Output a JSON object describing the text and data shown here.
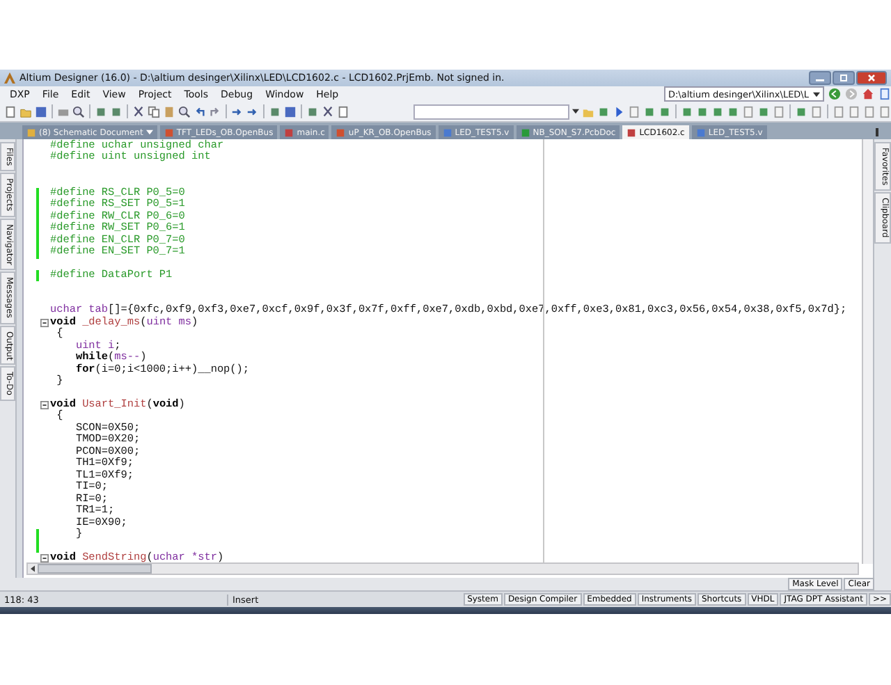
{
  "window": {
    "title": "Altium Designer (16.0) - D:\\altium desinger\\Xilinx\\LED\\LCD1602.c - LCD1602.PrjEmb. Not signed in."
  },
  "menu": [
    "DXP",
    "File",
    "Edit",
    "View",
    "Project",
    "Tools",
    "Debug",
    "Window",
    "Help"
  ],
  "path_field": {
    "value": "D:\\altium desinger\\Xilinx\\LED\\L"
  },
  "tabs": [
    {
      "label": "(8) Schematic Document",
      "kind": "menu",
      "selected": false
    },
    {
      "label": "TFT_LEDs_OB.OpenBus",
      "kind": "bus",
      "selected": false
    },
    {
      "label": "main.c",
      "kind": "c",
      "selected": false
    },
    {
      "label": "uP_KR_OB.OpenBus",
      "kind": "bus",
      "selected": false
    },
    {
      "label": "LED_TEST5.v",
      "kind": "v",
      "selected": false
    },
    {
      "label": "NB_SON_S7.PcbDoc",
      "kind": "pcb",
      "selected": false
    },
    {
      "label": "LCD1602.c",
      "kind": "c",
      "selected": true
    },
    {
      "label": "LED_TEST5.v",
      "kind": "v",
      "selected": false
    }
  ],
  "left_panels": [
    "Files",
    "Projects",
    "Navigator",
    "Messages",
    "Output",
    "To-Do"
  ],
  "right_panels": [
    "Favorites",
    "Clipboard"
  ],
  "code_lines": [
    {
      "changed": false,
      "foldable": false,
      "segments": [
        {
          "t": "#define uchar unsigned char",
          "kind": "dir"
        }
      ]
    },
    {
      "changed": false,
      "foldable": false,
      "segments": [
        {
          "t": "#define uint unsigned int",
          "kind": "dir"
        }
      ]
    },
    {
      "changed": false,
      "foldable": false
    },
    {
      "changed": false,
      "foldable": false
    },
    {
      "changed": true,
      "foldable": false,
      "segments": [
        {
          "t": "#define RS_CLR P0_5=0",
          "kind": "dir"
        }
      ]
    },
    {
      "changed": true,
      "foldable": false,
      "segments": [
        {
          "t": "#define RS_SET P0_5=1",
          "kind": "dir"
        }
      ]
    },
    {
      "changed": true,
      "foldable": false,
      "segments": [
        {
          "t": "#define RW_CLR P0_6=0",
          "kind": "dir"
        }
      ]
    },
    {
      "changed": true,
      "foldable": false,
      "segments": [
        {
          "t": "#define RW_SET P0_6=1",
          "kind": "dir"
        }
      ]
    },
    {
      "changed": true,
      "foldable": false,
      "segments": [
        {
          "t": "#define EN_CLR P0_7=0",
          "kind": "dir"
        }
      ]
    },
    {
      "changed": true,
      "foldable": false,
      "segments": [
        {
          "t": "#define EN_SET P0_7=1",
          "kind": "dir"
        }
      ]
    },
    {
      "changed": false,
      "foldable": false
    },
    {
      "changed": true,
      "foldable": false,
      "segments": [
        {
          "t": "#define DataPort P1",
          "kind": "dir"
        }
      ]
    },
    {
      "changed": false,
      "foldable": false
    },
    {
      "changed": false,
      "foldable": false
    },
    {
      "changed": false,
      "foldable": false,
      "segments": [
        {
          "t": "uchar tab",
          "kind": "type"
        },
        {
          "t": "[]={0xfc,0xf9,0xf3,0xe7,0xcf,0x9f,0x3f,0x7f,0xff,0xe7,0xdb,0xbd,0xe7,0xff,0xe3,0x81,0xc3,0x56,0x54,0x38,0xf5,0x7d};",
          "kind": "plain"
        }
      ]
    },
    {
      "changed": false,
      "foldable": true,
      "segments": [
        {
          "t": "void",
          "kind": "kw"
        },
        {
          "t": " _delay_ms",
          "kind": "fn"
        },
        {
          "t": "(",
          "kind": "plain"
        },
        {
          "t": "uint ms",
          "kind": "type"
        },
        {
          "t": ")",
          "kind": "plain"
        }
      ]
    },
    {
      "changed": false,
      "foldable": false,
      "segments": [
        {
          "t": " {",
          "kind": "plain"
        }
      ]
    },
    {
      "changed": false,
      "foldable": false,
      "segments": [
        {
          "t": "    uint i",
          "kind": "type"
        },
        {
          "t": ";",
          "kind": "plain"
        }
      ]
    },
    {
      "changed": false,
      "foldable": false,
      "segments": [
        {
          "t": "    while",
          "kind": "kw"
        },
        {
          "t": "(",
          "kind": "plain"
        },
        {
          "t": "ms--",
          "kind": "type"
        },
        {
          "t": ")",
          "kind": "plain"
        }
      ]
    },
    {
      "changed": false,
      "foldable": false,
      "segments": [
        {
          "t": "    for",
          "kind": "kw"
        },
        {
          "t": "(i=0;i<1000;i++)__nop();",
          "kind": "plain"
        }
      ]
    },
    {
      "changed": false,
      "foldable": false,
      "segments": [
        {
          "t": " }",
          "kind": "plain"
        }
      ]
    },
    {
      "changed": false,
      "foldable": false
    },
    {
      "changed": false,
      "foldable": true,
      "segments": [
        {
          "t": "void",
          "kind": "kw"
        },
        {
          "t": " Usart_Init",
          "kind": "fn"
        },
        {
          "t": "(",
          "kind": "plain"
        },
        {
          "t": "void",
          "kind": "kw"
        },
        {
          "t": ")",
          "kind": "plain"
        }
      ]
    },
    {
      "changed": false,
      "foldable": false,
      "segments": [
        {
          "t": " {",
          "kind": "plain"
        }
      ]
    },
    {
      "changed": false,
      "foldable": false,
      "segments": [
        {
          "t": "    SCON=0X50;",
          "kind": "plain"
        }
      ]
    },
    {
      "changed": false,
      "foldable": false,
      "segments": [
        {
          "t": "    TMOD=0X20;",
          "kind": "plain"
        }
      ]
    },
    {
      "changed": false,
      "foldable": false,
      "segments": [
        {
          "t": "    PCON=0X00;",
          "kind": "plain"
        }
      ]
    },
    {
      "changed": false,
      "foldable": false,
      "segments": [
        {
          "t": "    TH1=0Xf9;",
          "kind": "plain"
        }
      ]
    },
    {
      "changed": false,
      "foldable": false,
      "segments": [
        {
          "t": "    TL1=0Xf9;",
          "kind": "plain"
        }
      ]
    },
    {
      "changed": false,
      "foldable": false,
      "segments": [
        {
          "t": "    TI=0;",
          "kind": "plain"
        }
      ]
    },
    {
      "changed": false,
      "foldable": false,
      "segments": [
        {
          "t": "    RI=0;",
          "kind": "plain"
        }
      ]
    },
    {
      "changed": false,
      "foldable": false,
      "segments": [
        {
          "t": "    TR1=1;",
          "kind": "plain"
        }
      ]
    },
    {
      "changed": false,
      "foldable": false,
      "segments": [
        {
          "t": "    IE=0X90;",
          "kind": "plain"
        }
      ]
    },
    {
      "changed": true,
      "foldable": false,
      "segments": [
        {
          "t": "    }",
          "kind": "plain"
        }
      ]
    },
    {
      "changed": true,
      "foldable": false
    },
    {
      "changed": false,
      "foldable": true,
      "segments": [
        {
          "t": "void",
          "kind": "kw"
        },
        {
          "t": " SendString",
          "kind": "fn"
        },
        {
          "t": "(",
          "kind": "plain"
        },
        {
          "t": "uchar *str",
          "kind": "type"
        },
        {
          "t": ")",
          "kind": "plain"
        }
      ]
    }
  ],
  "filter_buttons": [
    "Mask Level",
    "Clear"
  ],
  "status_bar": {
    "position": "118: 43",
    "mode": "Insert",
    "panels": [
      "System",
      "Design Compiler",
      "Embedded",
      "Instruments",
      "Shortcuts",
      "VHDL",
      "JTAG DPT Assistant",
      ">>"
    ]
  }
}
